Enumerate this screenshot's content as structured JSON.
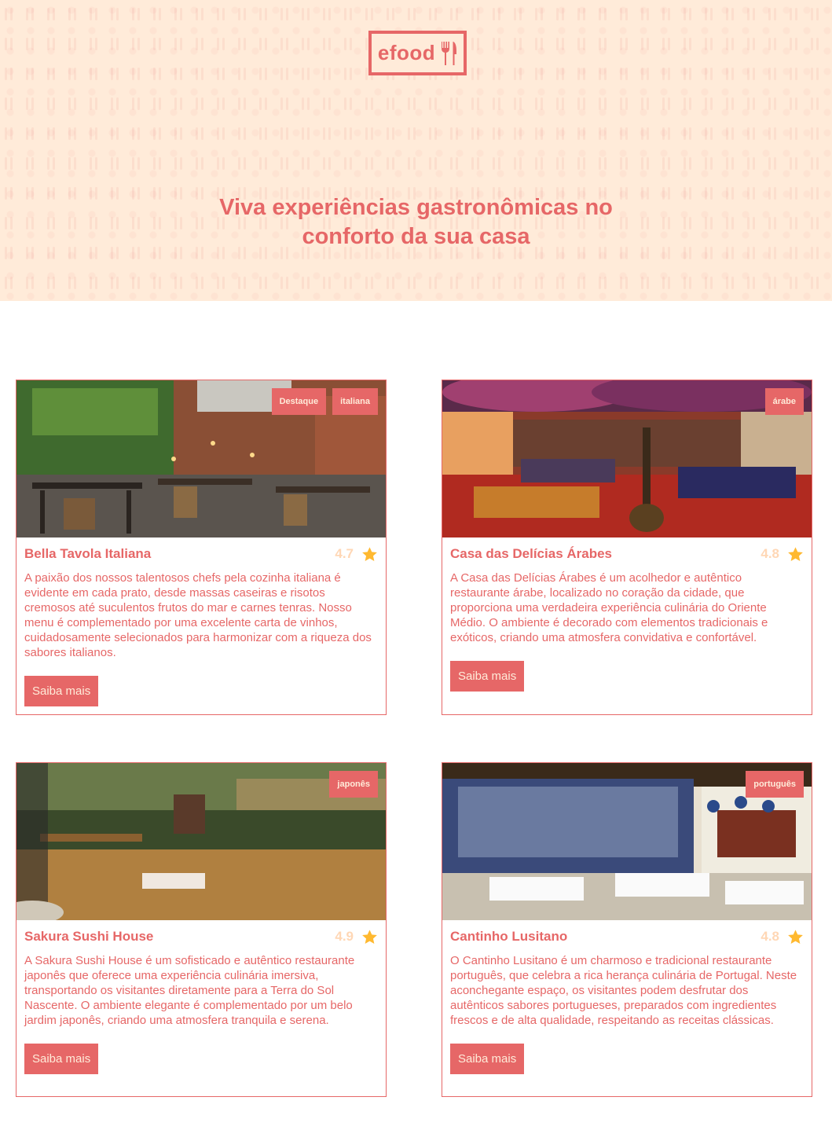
{
  "logo": {
    "text": "efood"
  },
  "hero": {
    "title_line1": "Viva experiências gastronômicas no",
    "title_line2": "conforto da sua casa"
  },
  "restaurants": [
    {
      "name": "Bella Tavola Italiana",
      "rating": "4.7",
      "tags": [
        "Destaque",
        "italiana"
      ],
      "description": "A paixão dos nossos talentosos chefs pela cozinha italiana é evidente em cada prato, desde massas caseiras e risotos cremosos até suculentos frutos do mar e carnes tenras. Nosso menu é complementado por uma excelente carta de vinhos, cuidadosamente selecionados para harmonizar com a riqueza dos sabores italianos.",
      "button": "Saiba mais"
    },
    {
      "name": "Casa das Delícias Árabes",
      "rating": "4.8",
      "tags": [
        "árabe"
      ],
      "description": "A Casa das Delícias Árabes é um acolhedor e autêntico restaurante árabe, localizado no coração da cidade, que proporciona uma verdadeira experiência culinária do Oriente Médio. O ambiente é decorado com elementos tradicionais e exóticos, criando uma atmosfera convidativa e confortável.",
      "button": "Saiba mais"
    },
    {
      "name": "Sakura Sushi House",
      "rating": "4.9",
      "tags": [
        "japonês"
      ],
      "description": "A Sakura Sushi House é um sofisticado e autêntico restaurante japonês que oferece uma experiência culinária imersiva, transportando os visitantes diretamente para a Terra do Sol Nascente. O ambiente elegante é complementado por um belo jardim japonês, criando uma atmosfera tranquila e serena.",
      "button": "Saiba mais"
    },
    {
      "name": "Cantinho Lusitano",
      "rating": "4.8",
      "tags": [
        "português"
      ],
      "description": "O Cantinho Lusitano é um charmoso e tradicional restaurante português, que celebra a rica herança culinária de Portugal. Neste aconchegante espaço, os visitantes podem desfrutar dos autênticos sabores portugueses, preparados com ingredientes frescos e de alta qualidade, respeitando as receitas clássicas.",
      "button": "Saiba mais"
    }
  ],
  "colors": {
    "primary": "#E66767",
    "cream": "#FFEBD9",
    "star": "#FFB930",
    "rating_text": "#FFD7B5"
  },
  "icons": {
    "logo": "fork-knife-icon",
    "rating": "star-icon"
  }
}
